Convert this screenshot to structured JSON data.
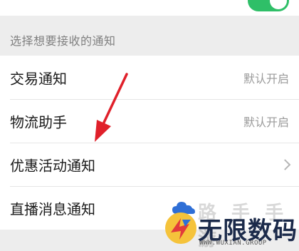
{
  "section_header": "选择想要接收的通知",
  "notifications": [
    {
      "label": "交易通知",
      "value": "默认开启"
    },
    {
      "label": "物流助手",
      "value": "默认开启"
    },
    {
      "label": "优惠活动通知",
      "value": ""
    },
    {
      "label": "直播消息通知",
      "value": ""
    }
  ],
  "watermark": {
    "top_text": "路 手 手 游",
    "brand": "无限数码",
    "url": "WWW.WUXIAN.GROUP"
  },
  "colors": {
    "toggle_on": "#2fbf68",
    "annotation_arrow": "#e0202a",
    "brand_dark": "#1b2a4a"
  }
}
